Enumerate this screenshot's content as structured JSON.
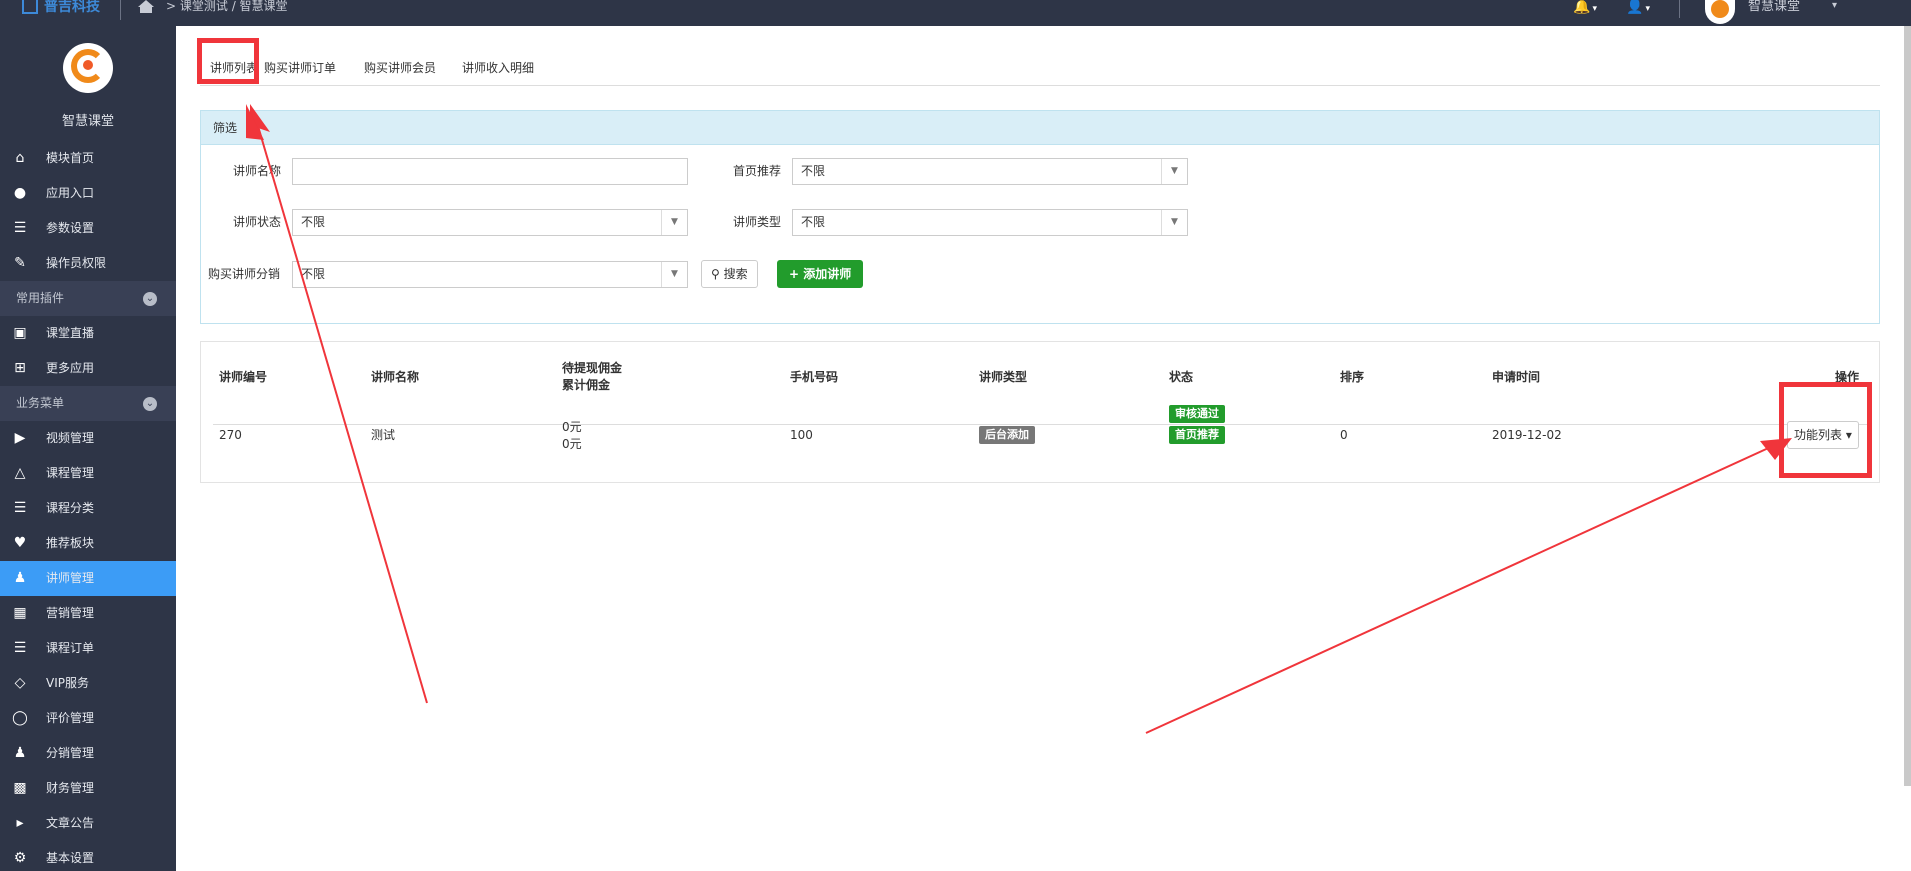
{
  "topbar": {
    "brand": "普吉科技",
    "breadcrumb": "课堂测试 / 智慧课堂",
    "user_name": "智慧课堂"
  },
  "sidebar": {
    "site_name": "智慧课堂",
    "items": [
      {
        "label": "模块首页",
        "icon": "home-icon"
      },
      {
        "label": "应用入口",
        "icon": "comment-icon"
      },
      {
        "label": "参数设置",
        "icon": "list-icon"
      },
      {
        "label": "操作员权限",
        "icon": "file-edit-icon"
      }
    ],
    "group1": "常用插件",
    "plugins": [
      {
        "label": "课堂直播",
        "icon": "live-icon"
      },
      {
        "label": "更多应用",
        "icon": "plus-box-icon"
      }
    ],
    "group2": "业务菜单",
    "business": [
      {
        "label": "视频管理",
        "icon": "play-icon"
      },
      {
        "label": "课程管理",
        "icon": "graduation-cap-icon"
      },
      {
        "label": "课程分类",
        "icon": "list-icon"
      },
      {
        "label": "推荐板块",
        "icon": "heart-icon"
      },
      {
        "label": "讲师管理",
        "icon": "teacher-icon"
      },
      {
        "label": "营销管理",
        "icon": "gift-icon"
      },
      {
        "label": "课程订单",
        "icon": "list-ol-icon"
      },
      {
        "label": "VIP服务",
        "icon": "diamond-icon"
      },
      {
        "label": "评价管理",
        "icon": "chat-icon"
      },
      {
        "label": "分销管理",
        "icon": "users-icon"
      },
      {
        "label": "财务管理",
        "icon": "money-icon"
      },
      {
        "label": "文章公告",
        "icon": "volume-icon"
      },
      {
        "label": "基本设置",
        "icon": "gear-icon"
      }
    ]
  },
  "tabs": [
    "讲师列表",
    "购买讲师订单",
    "购买讲师会员",
    "讲师收入明细"
  ],
  "filter": {
    "title": "筛选",
    "name_label": "讲师名称",
    "name_value": "",
    "home_label": "首页推荐",
    "home_value": "不限",
    "status_label": "讲师状态",
    "status_value": "不限",
    "type_label": "讲师类型",
    "type_value": "不限",
    "dist_label": "购买讲师分销",
    "dist_value": "不限",
    "search_btn": "搜索",
    "add_btn": "添加讲师"
  },
  "table": {
    "headers": [
      "讲师编号",
      "讲师名称",
      "待提现佣金",
      "累计佣金",
      "手机号码",
      "讲师类型",
      "状态",
      "排序",
      "申请时间",
      "操作"
    ],
    "rows": [
      {
        "id": "270",
        "name": "测试",
        "pending": "0元",
        "total": "0元",
        "phone": "100",
        "type": "后台添加",
        "status1": "审核通过",
        "status2": "首页推荐",
        "sort": "0",
        "date": "2019-12-02",
        "action": "功能列表"
      }
    ]
  },
  "colors": {
    "sidebar_bg": "#2e3547",
    "active": "#3c9cf6",
    "green": "#229c2c",
    "annotation_red": "#f0353b"
  }
}
